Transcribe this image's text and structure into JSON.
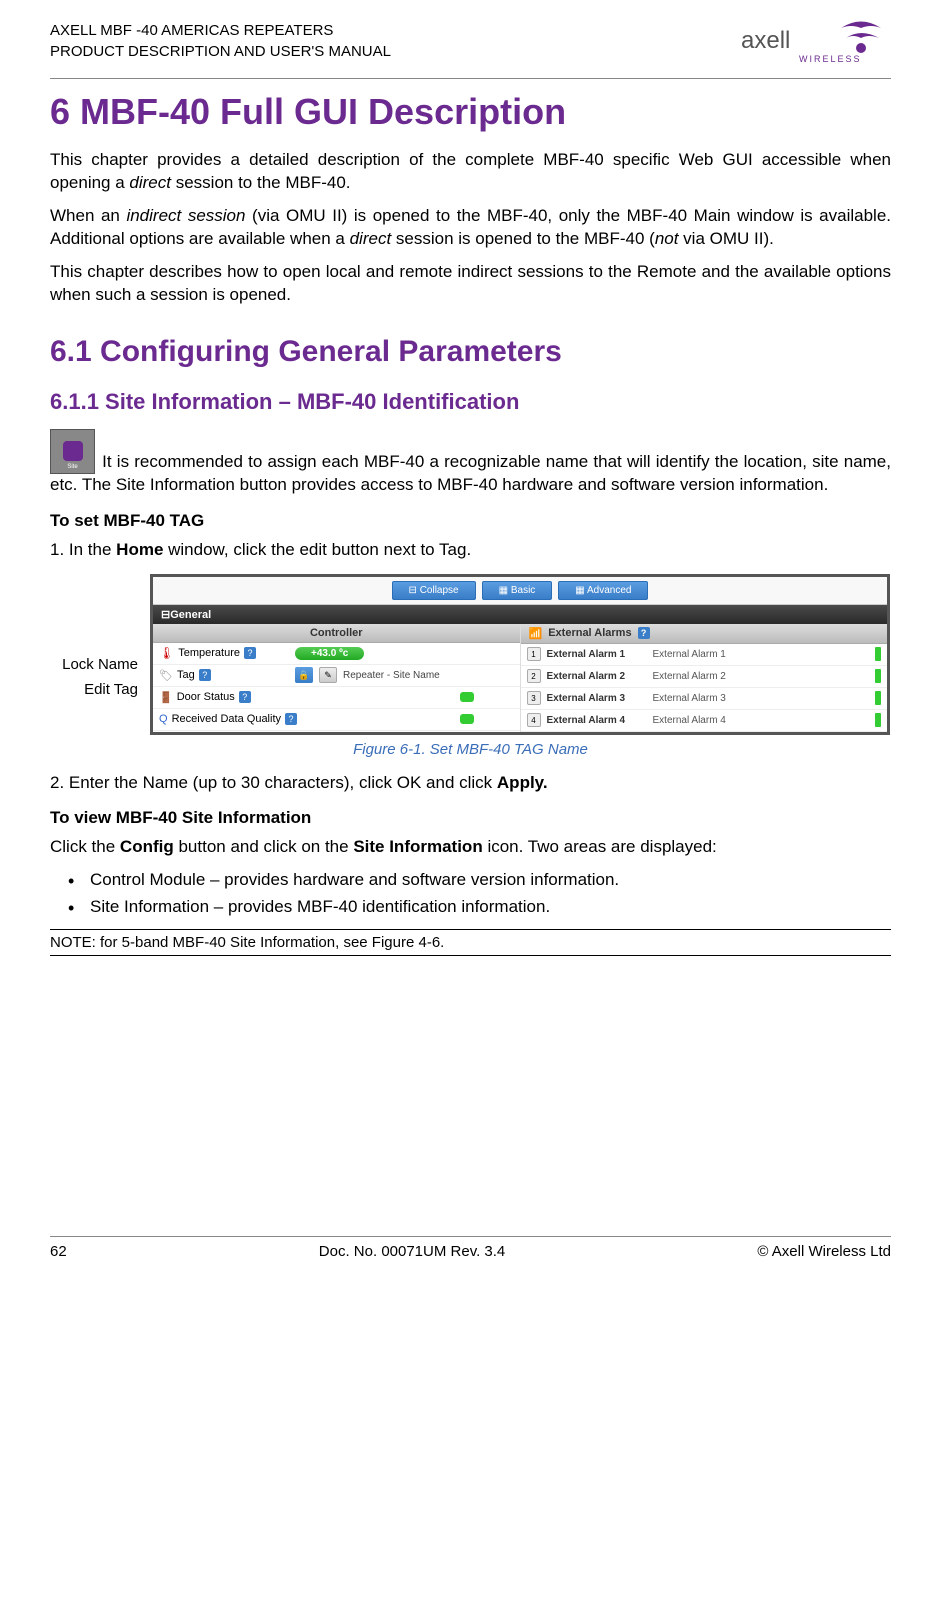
{
  "header": {
    "line1": "AXELL MBF -40 AMERICAS REPEATERS",
    "line2": "PRODUCT DESCRIPTION AND USER'S MANUAL",
    "logo_brand": "axell",
    "logo_sub": "WIRELESS"
  },
  "h1": "6 MBF-40 Full GUI Description",
  "p1a": "This chapter provides a detailed description of the complete MBF-40 specific Web GUI accessible when opening a ",
  "p1b": "direct",
  "p1c": " session to the MBF-40.",
  "p2a": "When an ",
  "p2b": "indirect session",
  "p2c": " (via OMU II) is opened to the MBF-40, only the MBF-40 Main window is available. Additional options are available when a ",
  "p2d": "direct",
  "p2e": " session is opened to the MBF-40 (",
  "p2f": "not",
  "p2g": " via OMU II).",
  "p3": "This chapter describes how to open local and remote indirect sessions to the Remote and the available options when such a session is opened.",
  "h2": "6.1   Configuring General Parameters",
  "h3": "6.1.1   Site Information – MBF-40 Identification",
  "site_icon_label": "Site Information",
  "p4": " It is recommended to assign each MBF-40 a recognizable name that will identify the location, site name, etc.  The Site Information button provides access to MBF-40 hardware and software version information.",
  "sub1": "To set MBF-40 TAG",
  "step1a": "1.  In the ",
  "step1b": "Home",
  "step1c": " window, click the edit button next to Tag.",
  "labels": {
    "lock": "Lock Name",
    "edit": "Edit Tag"
  },
  "screenshot": {
    "topbar": {
      "collapse": "Collapse",
      "basic": "Basic",
      "advanced": "Advanced"
    },
    "general": "General",
    "controller": "Controller",
    "external_alarms": "External Alarms",
    "rows": {
      "temp_label": "Temperature",
      "temp_value": "+43.0 ºc",
      "tag_label": "Tag",
      "tag_value": "Repeater - Site Name",
      "door_label": "Door Status",
      "rdq_label": "Received Data Quality"
    },
    "ext": [
      {
        "num": "1",
        "label": "External Alarm 1",
        "value": "External Alarm 1"
      },
      {
        "num": "2",
        "label": "External Alarm 2",
        "value": "External Alarm 2"
      },
      {
        "num": "3",
        "label": "External Alarm 3",
        "value": "External Alarm 3"
      },
      {
        "num": "4",
        "label": "External Alarm 4",
        "value": "External Alarm 4"
      }
    ]
  },
  "figure_caption": "Figure 6-1. Set MBF-40 TAG Name",
  "step2a": "2.  Enter the Name (up to 30 characters), click OK and click ",
  "step2b": "Apply.",
  "sub2": "To view MBF-40 Site Information",
  "p5a": "Click the ",
  "p5b": "Config",
  "p5c": " button and click on the ",
  "p5d": "Site Information",
  "p5e": " icon. Two areas are displayed:",
  "bullets": [
    "Control Module – provides hardware and software version information.",
    "Site Information – provides MBF-40 identification information."
  ],
  "note": "NOTE: for 5-band MBF-40 Site Information, see Figure 4-6.",
  "footer": {
    "page": "62",
    "doc": "Doc. No. 00071UM Rev. 3.4",
    "copyright": "© Axell Wireless Ltd"
  }
}
